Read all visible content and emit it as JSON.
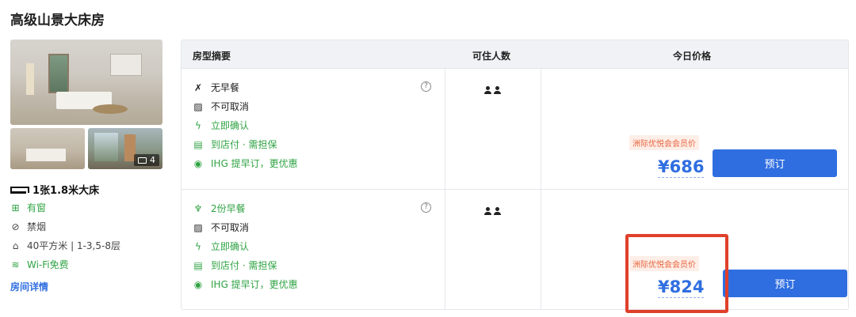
{
  "room_title": "高级山景大床房",
  "photo_count": "4",
  "bed": "1张1.8米大床",
  "features": [
    {
      "icon": "window-icon",
      "text": "有窗",
      "color": "green"
    },
    {
      "icon": "no-smoking-icon",
      "text": "禁烟",
      "color": "gray"
    },
    {
      "icon": "area-icon",
      "text": "40平方米 | 1-3,5-8层",
      "color": "gray"
    },
    {
      "icon": "wifi-icon",
      "text": "Wi-Fi免费",
      "color": "green"
    }
  ],
  "details_link": "房间详情",
  "table": {
    "headers": [
      "房型摘要",
      "可住人数",
      "今日价格"
    ],
    "rows": [
      {
        "options": [
          {
            "icon": "no-breakfast-icon",
            "text": "无早餐",
            "color": "dark"
          },
          {
            "icon": "no-cancel-icon",
            "text": "不可取消",
            "color": "dark"
          },
          {
            "icon": "lightning-icon",
            "text": "立即确认",
            "color": "green"
          },
          {
            "icon": "pay-at-hotel-icon",
            "text": "到店付 · 需担保",
            "color": "green"
          },
          {
            "icon": "ihg-icon",
            "text": "IHG 提早订，更优惠",
            "color": "green"
          }
        ],
        "guests": 2,
        "member_label": "洲际优悦会会员价",
        "price": "¥686",
        "book_label": "预订"
      },
      {
        "options": [
          {
            "icon": "breakfast-icon",
            "text": "2份早餐",
            "color": "green"
          },
          {
            "icon": "no-cancel-icon",
            "text": "不可取消",
            "color": "dark"
          },
          {
            "icon": "lightning-icon",
            "text": "立即确认",
            "color": "green"
          },
          {
            "icon": "pay-at-hotel-icon",
            "text": "到店付 · 需担保",
            "color": "green"
          },
          {
            "icon": "ihg-icon",
            "text": "IHG 提早订，更优惠",
            "color": "green"
          }
        ],
        "guests": 2,
        "member_label": "洲际优悦会会员价",
        "price": "¥824",
        "book_label": "预订"
      }
    ]
  },
  "colors": {
    "accent": "#2f6ee0",
    "green": "#2fa343",
    "member": "#e8643c",
    "highlight": "#e0402a"
  }
}
